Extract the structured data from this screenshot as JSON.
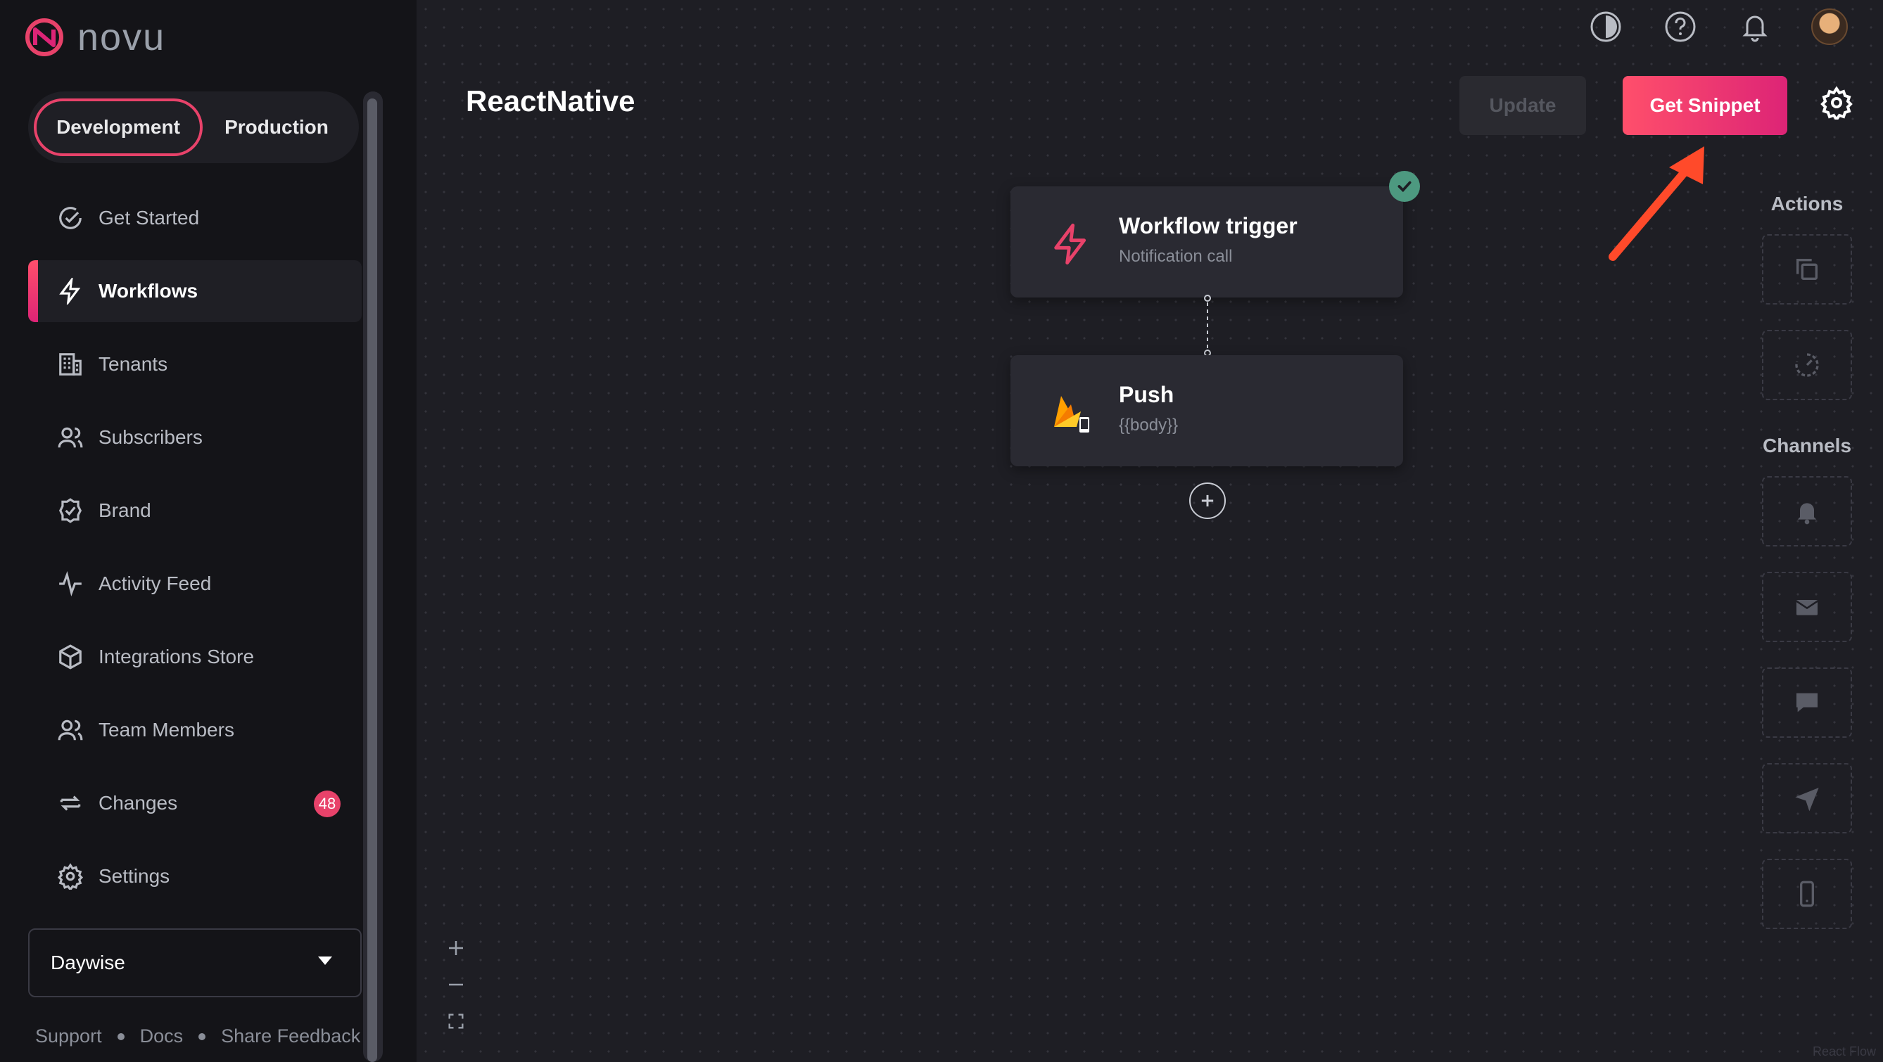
{
  "app": {
    "name": "novu"
  },
  "environment": {
    "active": "Development",
    "inactive": "Production"
  },
  "sidebar": {
    "items": [
      {
        "label": "Get Started",
        "icon": "check-circle-icon"
      },
      {
        "label": "Workflows",
        "icon": "lightning-icon",
        "active": true
      },
      {
        "label": "Tenants",
        "icon": "building-icon"
      },
      {
        "label": "Subscribers",
        "icon": "users-icon"
      },
      {
        "label": "Brand",
        "icon": "badge-check-icon"
      },
      {
        "label": "Activity Feed",
        "icon": "activity-icon"
      },
      {
        "label": "Integrations Store",
        "icon": "cube-icon"
      },
      {
        "label": "Team Members",
        "icon": "team-icon"
      },
      {
        "label": "Changes",
        "icon": "refresh-icon",
        "badge": "48"
      },
      {
        "label": "Settings",
        "icon": "gear-icon"
      }
    ],
    "org_select": "Daywise",
    "footer": {
      "support": "Support",
      "docs": "Docs",
      "feedback": "Share Feedback"
    }
  },
  "header": {
    "title": "ReactNative",
    "update_label": "Update",
    "snippet_label": "Get Snippet"
  },
  "workflow": {
    "trigger": {
      "title": "Workflow trigger",
      "subtitle": "Notification call"
    },
    "push": {
      "title": "Push",
      "subtitle": "{{body}}"
    }
  },
  "panel": {
    "actions_label": "Actions",
    "channels_label": "Channels"
  },
  "canvas": {
    "watermark": "React Flow"
  },
  "colors": {
    "accent": "#e8426a",
    "gradient_end": "#dd2476",
    "success": "#4d9980",
    "arrow": "#ff4a2a"
  }
}
